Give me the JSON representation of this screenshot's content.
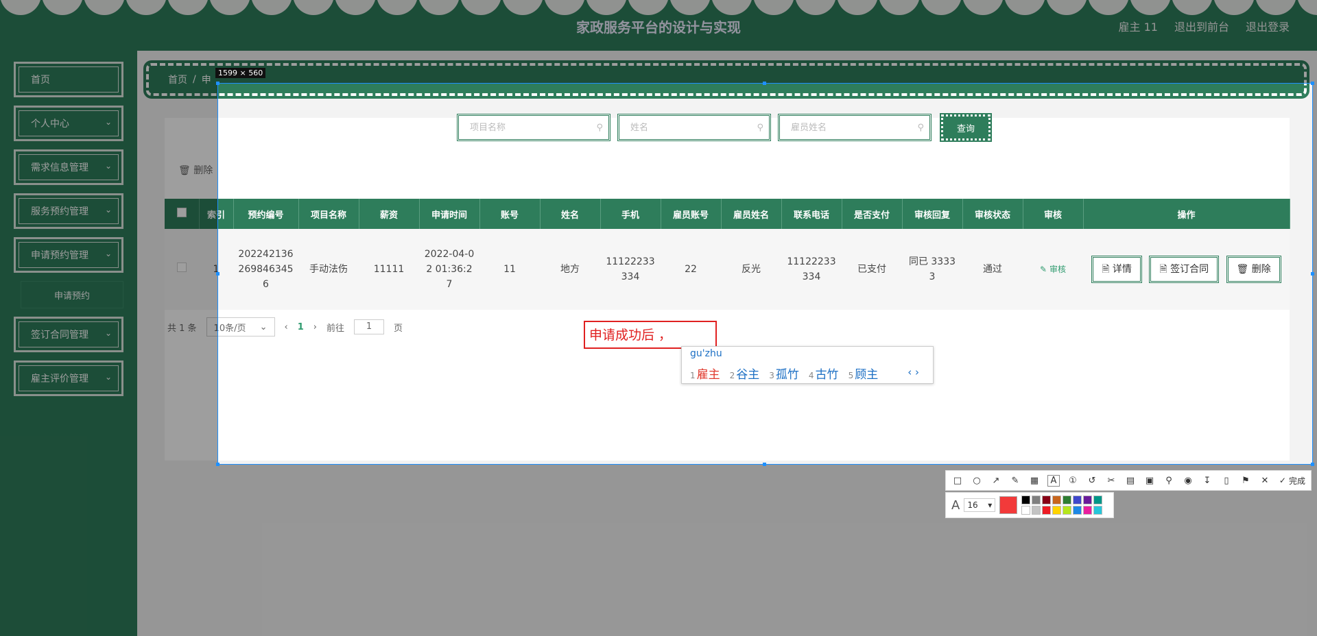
{
  "header": {
    "title": "家政服务平台的设计与实现",
    "links": [
      "雇主 11",
      "退出到前台",
      "退出登录"
    ]
  },
  "sidebar": {
    "items": [
      {
        "label": "首页",
        "chevron": false
      },
      {
        "label": "个人中心",
        "chevron": true
      },
      {
        "label": "需求信息管理",
        "chevron": true
      },
      {
        "label": "服务预约管理",
        "chevron": true
      },
      {
        "label": "申请预约管理",
        "chevron": true
      },
      {
        "label": "申请预约",
        "sub": true
      },
      {
        "label": "签订合同管理",
        "chevron": true
      },
      {
        "label": "雇主评价管理",
        "chevron": true
      }
    ]
  },
  "breadcrumb": {
    "home": "首页",
    "sep": "/",
    "current": "申"
  },
  "toolbar_top": {
    "delete_label": "删除"
  },
  "search": {
    "project_placeholder": "项目名称",
    "name_placeholder": "姓名",
    "employee_placeholder": "雇员姓名",
    "query_label": "查询"
  },
  "table": {
    "headers": [
      "索引",
      "预约编号",
      "项目名称",
      "薪资",
      "申请时间",
      "账号",
      "姓名",
      "手机",
      "雇员账号",
      "雇员姓名",
      "联系电话",
      "是否支付",
      "审核回复",
      "审核状态",
      "审核",
      "操作"
    ],
    "rows": [
      {
        "index": "1",
        "booking_no": "2022421362698463456",
        "project": "手动法伤",
        "salary": "11111",
        "apply_time": "2022-04-02 01:36:27",
        "account": "11",
        "name": "地方",
        "phone": "11122233334",
        "employee_account": "22",
        "employee_name": "反光",
        "contact_phone": "11122233334",
        "paid": "已支付",
        "reply": "同已 33333",
        "status": "通过",
        "audit_label": "审核",
        "actions": {
          "detail": "详情",
          "contract": "签订合同",
          "delete": "删除"
        }
      }
    ]
  },
  "pager": {
    "total": "共 1 条",
    "page_size": "10条/页",
    "current_page": "1",
    "goto_prefix": "前往",
    "goto_value": "1",
    "goto_suffix": "页"
  },
  "capture": {
    "size_label": "1599 × 560",
    "annotation_text": "申请成功后 ，",
    "ime_pinyin": "gu'zhu",
    "ime_candidates": [
      {
        "n": "1",
        "text": "雇主"
      },
      {
        "n": "2",
        "text": "谷主"
      },
      {
        "n": "3",
        "text": "孤竹"
      },
      {
        "n": "4",
        "text": "古竹"
      },
      {
        "n": "5",
        "text": "顾主"
      }
    ],
    "done_label": "完成",
    "font_size": "16",
    "current_color": "#f23a3a",
    "palette": [
      "#000000",
      "#7f7f7f",
      "#880015",
      "#c8661e",
      "#2e7d32",
      "#3f48cc",
      "#6a1b9a",
      "#009688",
      "#ffffff",
      "#c3c3c3",
      "#ed1c24",
      "#ffd400",
      "#b5e61d",
      "#1e88e5",
      "#e91e9f",
      "#26c6da"
    ]
  },
  "colors": {
    "accent": "#2e7d5b",
    "annotation": "#e02020"
  }
}
